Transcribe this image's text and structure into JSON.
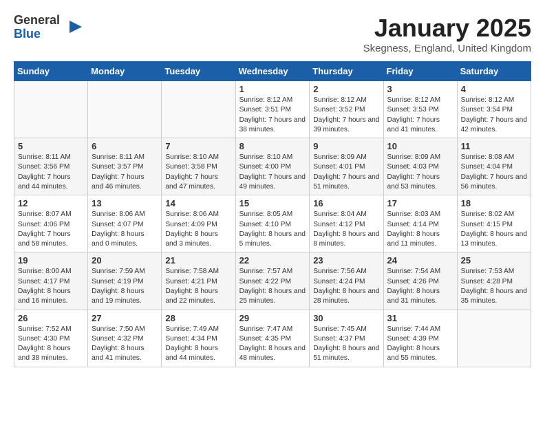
{
  "logo": {
    "general": "General",
    "blue": "Blue"
  },
  "header": {
    "title": "January 2025",
    "location": "Skegness, England, United Kingdom"
  },
  "weekdays": [
    "Sunday",
    "Monday",
    "Tuesday",
    "Wednesday",
    "Thursday",
    "Friday",
    "Saturday"
  ],
  "weeks": [
    [
      {
        "day": "",
        "info": ""
      },
      {
        "day": "",
        "info": ""
      },
      {
        "day": "",
        "info": ""
      },
      {
        "day": "1",
        "info": "Sunrise: 8:12 AM\nSunset: 3:51 PM\nDaylight: 7 hours and 38 minutes."
      },
      {
        "day": "2",
        "info": "Sunrise: 8:12 AM\nSunset: 3:52 PM\nDaylight: 7 hours and 39 minutes."
      },
      {
        "day": "3",
        "info": "Sunrise: 8:12 AM\nSunset: 3:53 PM\nDaylight: 7 hours and 41 minutes."
      },
      {
        "day": "4",
        "info": "Sunrise: 8:12 AM\nSunset: 3:54 PM\nDaylight: 7 hours and 42 minutes."
      }
    ],
    [
      {
        "day": "5",
        "info": "Sunrise: 8:11 AM\nSunset: 3:56 PM\nDaylight: 7 hours and 44 minutes."
      },
      {
        "day": "6",
        "info": "Sunrise: 8:11 AM\nSunset: 3:57 PM\nDaylight: 7 hours and 46 minutes."
      },
      {
        "day": "7",
        "info": "Sunrise: 8:10 AM\nSunset: 3:58 PM\nDaylight: 7 hours and 47 minutes."
      },
      {
        "day": "8",
        "info": "Sunrise: 8:10 AM\nSunset: 4:00 PM\nDaylight: 7 hours and 49 minutes."
      },
      {
        "day": "9",
        "info": "Sunrise: 8:09 AM\nSunset: 4:01 PM\nDaylight: 7 hours and 51 minutes."
      },
      {
        "day": "10",
        "info": "Sunrise: 8:09 AM\nSunset: 4:03 PM\nDaylight: 7 hours and 53 minutes."
      },
      {
        "day": "11",
        "info": "Sunrise: 8:08 AM\nSunset: 4:04 PM\nDaylight: 7 hours and 56 minutes."
      }
    ],
    [
      {
        "day": "12",
        "info": "Sunrise: 8:07 AM\nSunset: 4:06 PM\nDaylight: 7 hours and 58 minutes."
      },
      {
        "day": "13",
        "info": "Sunrise: 8:06 AM\nSunset: 4:07 PM\nDaylight: 8 hours and 0 minutes."
      },
      {
        "day": "14",
        "info": "Sunrise: 8:06 AM\nSunset: 4:09 PM\nDaylight: 8 hours and 3 minutes."
      },
      {
        "day": "15",
        "info": "Sunrise: 8:05 AM\nSunset: 4:10 PM\nDaylight: 8 hours and 5 minutes."
      },
      {
        "day": "16",
        "info": "Sunrise: 8:04 AM\nSunset: 4:12 PM\nDaylight: 8 hours and 8 minutes."
      },
      {
        "day": "17",
        "info": "Sunrise: 8:03 AM\nSunset: 4:14 PM\nDaylight: 8 hours and 11 minutes."
      },
      {
        "day": "18",
        "info": "Sunrise: 8:02 AM\nSunset: 4:15 PM\nDaylight: 8 hours and 13 minutes."
      }
    ],
    [
      {
        "day": "19",
        "info": "Sunrise: 8:00 AM\nSunset: 4:17 PM\nDaylight: 8 hours and 16 minutes."
      },
      {
        "day": "20",
        "info": "Sunrise: 7:59 AM\nSunset: 4:19 PM\nDaylight: 8 hours and 19 minutes."
      },
      {
        "day": "21",
        "info": "Sunrise: 7:58 AM\nSunset: 4:21 PM\nDaylight: 8 hours and 22 minutes."
      },
      {
        "day": "22",
        "info": "Sunrise: 7:57 AM\nSunset: 4:22 PM\nDaylight: 8 hours and 25 minutes."
      },
      {
        "day": "23",
        "info": "Sunrise: 7:56 AM\nSunset: 4:24 PM\nDaylight: 8 hours and 28 minutes."
      },
      {
        "day": "24",
        "info": "Sunrise: 7:54 AM\nSunset: 4:26 PM\nDaylight: 8 hours and 31 minutes."
      },
      {
        "day": "25",
        "info": "Sunrise: 7:53 AM\nSunset: 4:28 PM\nDaylight: 8 hours and 35 minutes."
      }
    ],
    [
      {
        "day": "26",
        "info": "Sunrise: 7:52 AM\nSunset: 4:30 PM\nDaylight: 8 hours and 38 minutes."
      },
      {
        "day": "27",
        "info": "Sunrise: 7:50 AM\nSunset: 4:32 PM\nDaylight: 8 hours and 41 minutes."
      },
      {
        "day": "28",
        "info": "Sunrise: 7:49 AM\nSunset: 4:34 PM\nDaylight: 8 hours and 44 minutes."
      },
      {
        "day": "29",
        "info": "Sunrise: 7:47 AM\nSunset: 4:35 PM\nDaylight: 8 hours and 48 minutes."
      },
      {
        "day": "30",
        "info": "Sunrise: 7:45 AM\nSunset: 4:37 PM\nDaylight: 8 hours and 51 minutes."
      },
      {
        "day": "31",
        "info": "Sunrise: 7:44 AM\nSunset: 4:39 PM\nDaylight: 8 hours and 55 minutes."
      },
      {
        "day": "",
        "info": ""
      }
    ]
  ]
}
